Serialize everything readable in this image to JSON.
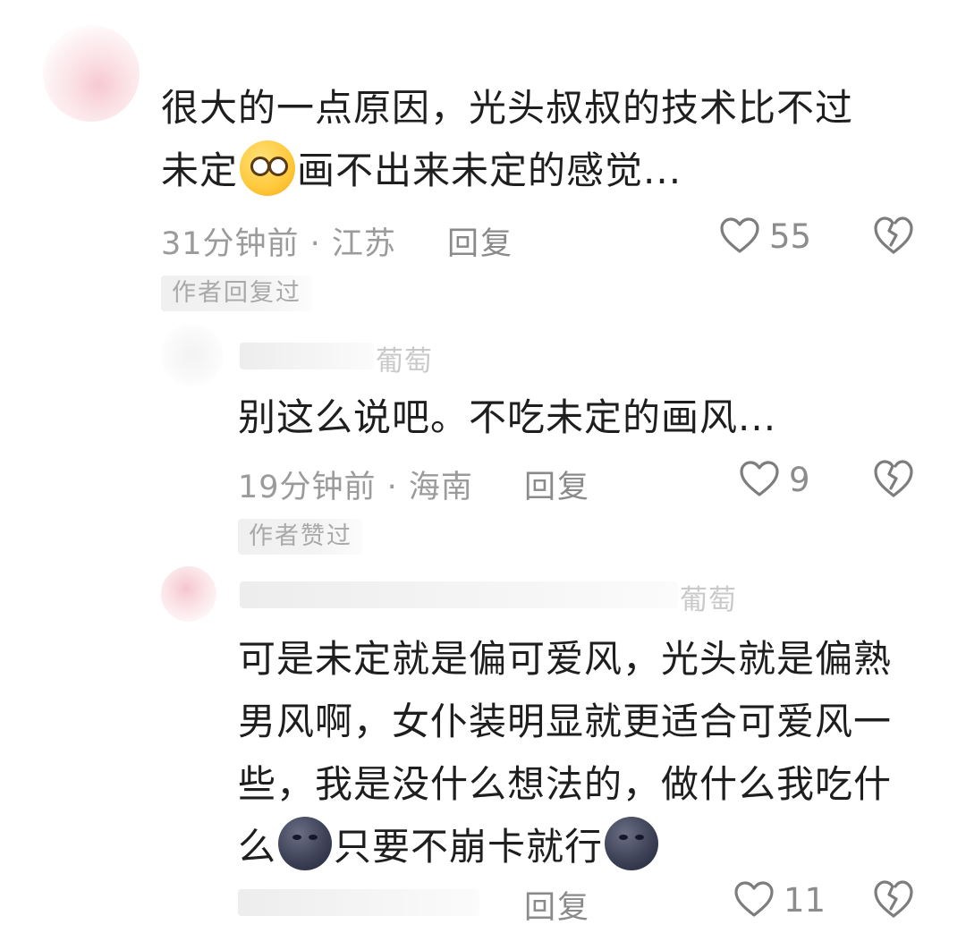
{
  "comments": [
    {
      "text_line1": "很大的一点原因，光头叔叔的技术比不过",
      "text_line2_a": "未定",
      "text_line2_b": "画不出来未定的感觉...",
      "emoji": "dizzy-face-icon",
      "meta": "31分钟前 · 江苏",
      "reply_label": "回复",
      "likes": "55",
      "badge": "作者回复过"
    },
    {
      "username_fragment": "葡萄",
      "text_line1": "别这么说吧。不吃未定的画风...",
      "meta": "19分钟前 · 海南",
      "reply_label": "回复",
      "likes": "9",
      "badge": "作者赞过"
    },
    {
      "username_fragment": "葡萄",
      "text_line1": "可是未定就是偏可爱风，光头就是偏熟",
      "text_line2": "男风啊，女仆装明显就更适合可爱风一",
      "text_line3": "些，我是没什么想法的，做什么我吃什",
      "text_line4_a": "么",
      "text_line4_b": "只要不崩卡就行",
      "emoji": "new-moon-face-icon",
      "reply_label": "回复",
      "likes": "11"
    }
  ],
  "colors": {
    "text": "#1e1e1e",
    "meta": "#9b9b9b",
    "icon": "#7d7d7d"
  }
}
